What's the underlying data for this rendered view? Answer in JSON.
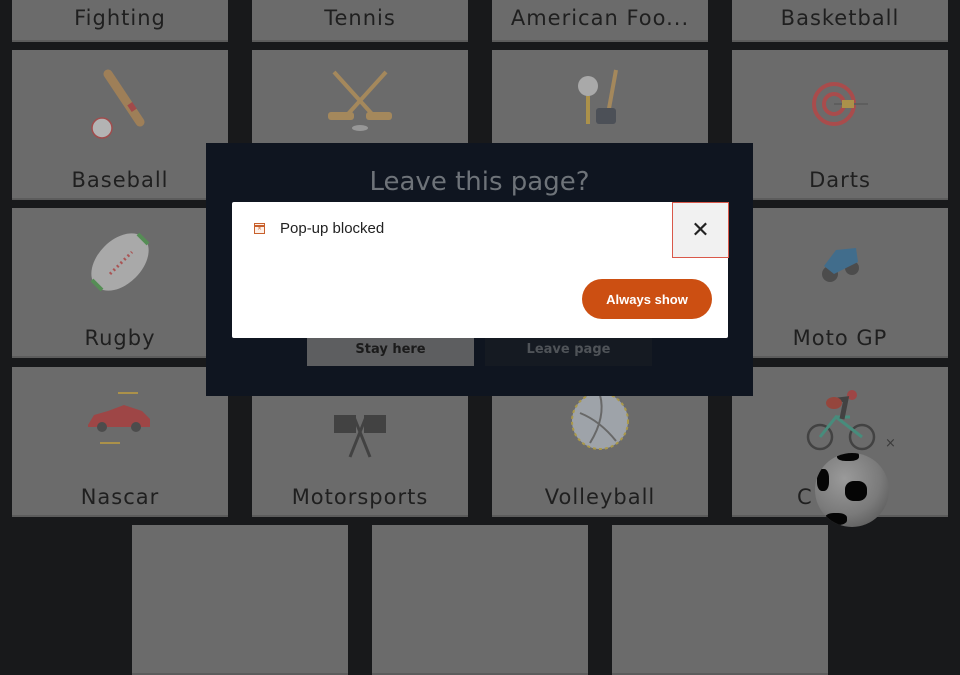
{
  "background": {
    "tiles": [
      {
        "label": "Fighting",
        "icon": "fighting-icon"
      },
      {
        "label": "Tennis",
        "icon": "tennis-icon"
      },
      {
        "label": "American Foo...",
        "icon": "american-football-icon"
      },
      {
        "label": "Basketball",
        "icon": "basketball-icon"
      },
      {
        "label": "Baseball",
        "icon": "baseball-bat-icon"
      },
      {
        "label": "",
        "icon": "hockey-sticks-icon"
      },
      {
        "label": "",
        "icon": "golf-club-icon"
      },
      {
        "label": "Darts",
        "icon": "dartboard-icon"
      },
      {
        "label": "Rugby",
        "icon": "rugby-ball-icon"
      },
      {
        "label": "",
        "icon": ""
      },
      {
        "label": "",
        "icon": ""
      },
      {
        "label": "Moto GP",
        "icon": "motorbike-icon"
      },
      {
        "label": "Nascar",
        "icon": "race-car-icon"
      },
      {
        "label": "Motorsports",
        "icon": "checkered-flags-icon"
      },
      {
        "label": "Volleyball",
        "icon": "volleyball-icon"
      },
      {
        "label": "C",
        "icon": "cyclist-icon"
      }
    ]
  },
  "leave_dialog": {
    "title": "Leave this page?",
    "stay_label": "Stay here",
    "leave_label": "Leave page"
  },
  "popup": {
    "icon": "popup-blocked-icon",
    "message": "Pop-up blocked",
    "close_symbol": "✕",
    "action_label": "Always show",
    "accent_color": "#cc4f12"
  },
  "floating_widget": {
    "icon": "soccer-ball-icon",
    "close_symbol": "×"
  }
}
